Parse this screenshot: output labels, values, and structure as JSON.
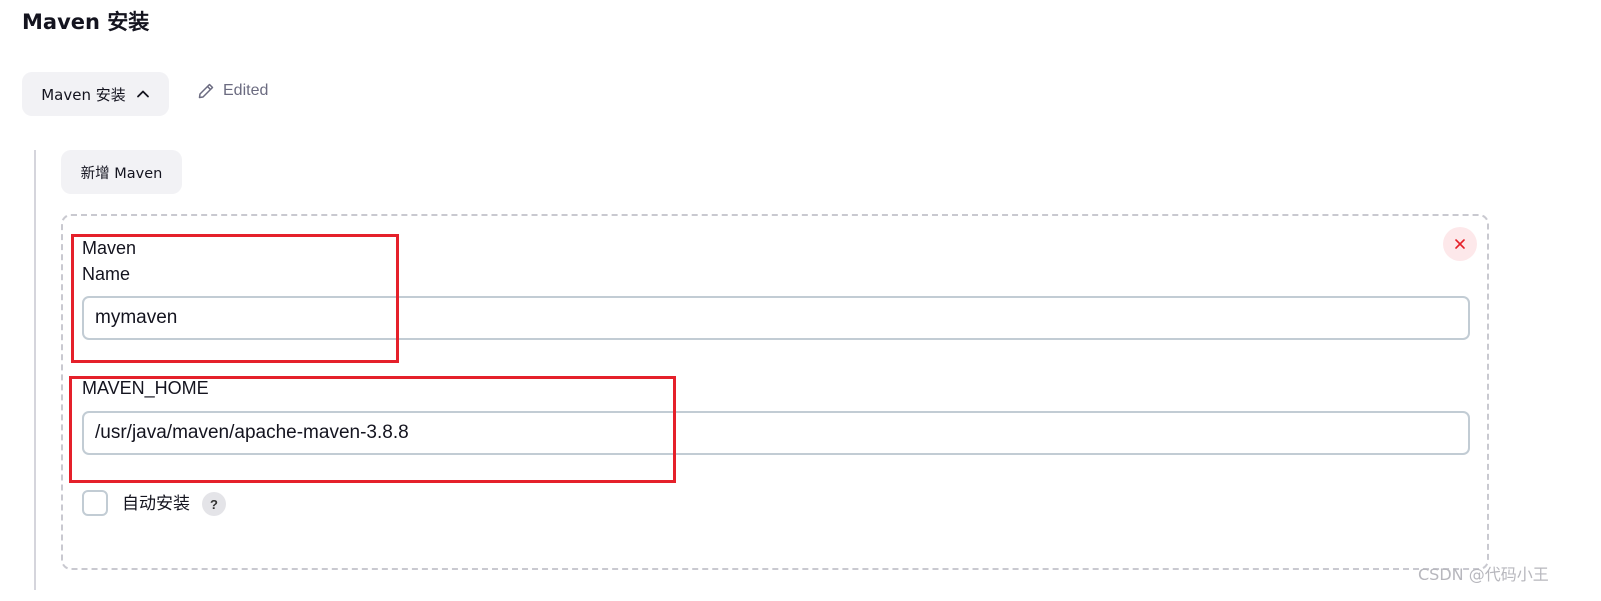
{
  "section": {
    "title": "Maven 安装"
  },
  "toggle": {
    "label": "Maven 安装",
    "icon": "chevron-up-icon"
  },
  "status": {
    "label": "Edited",
    "icon": "pencil-icon"
  },
  "add_button": {
    "label": "新增 Maven"
  },
  "card": {
    "close_icon": "close-icon",
    "name_field": {
      "label": "Maven\nName",
      "value": "mymaven"
    },
    "home_field": {
      "label": "MAVEN_HOME",
      "value": "/usr/java/maven/apache-maven-3.8.8"
    },
    "auto_install": {
      "label": "自动安装",
      "checked": false,
      "help_label": "?"
    }
  },
  "watermark": {
    "text": "CSDN @代码小王"
  },
  "colors": {
    "highlight": "#e5202a",
    "close_bg": "#fde8ea",
    "close_icon": "#e5202a",
    "button_bg": "#f2f2f5",
    "input_border": "#c2ccd4",
    "muted_text": "#6b6b80"
  }
}
